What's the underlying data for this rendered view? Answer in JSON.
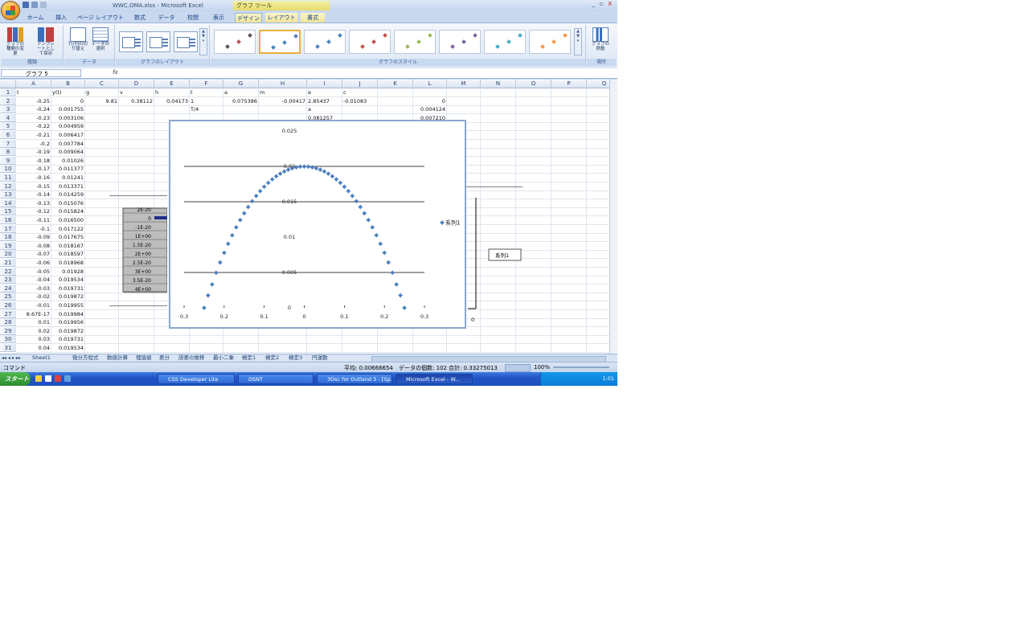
{
  "window": {
    "title": "WWC.OMA.xlsx - Microsoft Excel",
    "context_label": "グラフ ツール",
    "buttons": [
      "_",
      "▫",
      "X"
    ]
  },
  "tabs": [
    "ホーム",
    "挿入",
    "ページ レイアウト",
    "数式",
    "データ",
    "校閲",
    "表示",
    "デザイン",
    "レイアウト",
    "書式"
  ],
  "active_tab": "デザイン",
  "ribbon": {
    "groups": [
      {
        "label": "種類",
        "buttons": [
          "グラフの種類の変更",
          "テンプレートとして保存"
        ]
      },
      {
        "label": "データ",
        "buttons": [
          "行/列の切り替え",
          "データの選択"
        ]
      },
      {
        "label": "グラフのレイアウト"
      },
      {
        "label": "グラフのスタイル"
      },
      {
        "label": "場所",
        "buttons": [
          "グラフの移動"
        ]
      }
    ],
    "style_colors": [
      "#555555",
      "#4f81bd",
      "#4f81bd",
      "#c0504d",
      "#9bbb59",
      "#8064a2",
      "#4bacc6",
      "#f79646"
    ]
  },
  "formula_bar": {
    "name_box": "グラフ 5",
    "fx": "fx"
  },
  "columns": [
    "A",
    "B",
    "C",
    "D",
    "E",
    "F",
    "G",
    "H",
    "I",
    "J",
    "K",
    "L",
    "M",
    "N",
    "O",
    "P",
    "Q"
  ],
  "rows": [
    {
      "n": "1",
      "cells": {
        "A": "t",
        "B": "y(t)",
        "C": "g",
        "D": "v",
        "E": "h",
        "F": "t",
        "G": "a",
        "H": "m",
        "I": "e",
        "J": "c"
      }
    },
    {
      "n": "2",
      "cells": {
        "A": "-0.25",
        "B": "0",
        "C": "9.81",
        "D": "0.38112",
        "E": "0.04173",
        "F": "1",
        "G": "0.075386",
        "H": "-0.00417",
        "I": "2.85437",
        "J": "-0.01083",
        "L": "0"
      }
    },
    {
      "n": "3",
      "cells": {
        "A": "-0.24",
        "B": "0.001755",
        "F": "T/4",
        "I": "a",
        "L": "0.004124"
      }
    },
    {
      "n": "4",
      "cells": {
        "A": "-0.23",
        "B": "0.003106",
        "I": "0.081257",
        "L": "0.007210"
      }
    },
    {
      "n": "5",
      "cells": {
        "A": "-0.22",
        "B": "0.004959"
      }
    },
    {
      "n": "6",
      "cells": {
        "A": "-0.21",
        "B": "0.006417"
      }
    },
    {
      "n": "7",
      "cells": {
        "A": "-0.2",
        "B": "0.007784"
      }
    },
    {
      "n": "8",
      "cells": {
        "A": "-0.19",
        "B": "0.009064"
      }
    },
    {
      "n": "9",
      "cells": {
        "A": "-0.18",
        "B": "0.01026"
      }
    },
    {
      "n": "10",
      "cells": {
        "A": "-0.17",
        "B": "0.011377"
      }
    },
    {
      "n": "11",
      "cells": {
        "A": "-0.16",
        "B": "0.01241"
      }
    },
    {
      "n": "12",
      "cells": {
        "A": "-0.15",
        "B": "0.013371"
      }
    },
    {
      "n": "13",
      "cells": {
        "A": "-0.14",
        "B": "0.014259"
      }
    },
    {
      "n": "14",
      "cells": {
        "A": "-0.13",
        "B": "0.015076"
      }
    },
    {
      "n": "15",
      "cells": {
        "A": "-0.12",
        "B": "0.015824"
      }
    },
    {
      "n": "16",
      "cells": {
        "A": "-0.11",
        "B": "0.016500"
      }
    },
    {
      "n": "17",
      "cells": {
        "A": "-0.1",
        "B": "0.017122"
      }
    },
    {
      "n": "18",
      "cells": {
        "A": "-0.09",
        "B": "0.017675"
      }
    },
    {
      "n": "19",
      "cells": {
        "A": "-0.08",
        "B": "0.018167"
      }
    },
    {
      "n": "20",
      "cells": {
        "A": "-0.07",
        "B": "0.018597"
      }
    },
    {
      "n": "21",
      "cells": {
        "A": "-0.06",
        "B": "0.018968"
      }
    },
    {
      "n": "22",
      "cells": {
        "A": "-0.05",
        "B": "0.01928"
      }
    },
    {
      "n": "23",
      "cells": {
        "A": "-0.04",
        "B": "0.019534"
      }
    },
    {
      "n": "24",
      "cells": {
        "A": "-0.03",
        "B": "0.019731"
      }
    },
    {
      "n": "25",
      "cells": {
        "A": "-0.02",
        "B": "0.019872"
      }
    },
    {
      "n": "26",
      "cells": {
        "A": "-0.01",
        "B": "0.019955"
      }
    },
    {
      "n": "27",
      "cells": {
        "A": "8.67E-17",
        "B": "0.019984"
      }
    },
    {
      "n": "28",
      "cells": {
        "A": "0.01",
        "B": "0.019956"
      }
    },
    {
      "n": "29",
      "cells": {
        "A": "0.02",
        "B": "0.019872"
      }
    },
    {
      "n": "30",
      "cells": {
        "A": "0.03",
        "B": "0.019731"
      }
    },
    {
      "n": "31",
      "cells": {
        "A": "0.04",
        "B": "0.019534"
      }
    }
  ],
  "sheet_tabs": [
    "Sheet1",
    "微分方程式",
    "数値計算",
    "理論値",
    "差分",
    "誤差の推移",
    "最小二乗",
    "検定1",
    "検定2",
    "検定3",
    "円運動"
  ],
  "status": {
    "mode": "コマンド",
    "average": "平均: 0.00666654",
    "count": "データの個数: 102",
    "sum": "合計: 0.33275013",
    "zoom": "100%"
  },
  "taskbar": {
    "start": "スタート",
    "items": [
      "CSS Developer Lite",
      "DSNT",
      "3Dsc for Outland 3 - [Sp...",
      "Microsoft Excel - W..."
    ],
    "clock": "1:01"
  },
  "chart_data": {
    "type": "scatter",
    "title": "",
    "xlabel": "",
    "ylabel": "",
    "xlim": [
      -0.3,
      0.3
    ],
    "ylim": [
      0,
      0.025
    ],
    "x_tick_labels": [
      "0.3",
      "0.2",
      "0.1",
      "0",
      "0.1",
      "0.2",
      "0.3"
    ],
    "y_tick_labels": [
      "0",
      "0.005",
      "0.01",
      "0.015",
      "0.02",
      "0.025"
    ],
    "legend": {
      "entries": [
        "系列1"
      ],
      "position": "right"
    },
    "color": "#4f81bd",
    "series": [
      {
        "name": "系列1",
        "x": [
          -0.25,
          -0.24,
          -0.23,
          -0.22,
          -0.21,
          -0.2,
          -0.19,
          -0.18,
          -0.17,
          -0.16,
          -0.15,
          -0.14,
          -0.13,
          -0.12,
          -0.11,
          -0.1,
          -0.09,
          -0.08,
          -0.07,
          -0.06,
          -0.05,
          -0.04,
          -0.03,
          -0.02,
          -0.01,
          0,
          0.01,
          0.02,
          0.03,
          0.04,
          0.05,
          0.06,
          0.07,
          0.08,
          0.09,
          0.1,
          0.11,
          0.12,
          0.13,
          0.14,
          0.15,
          0.16,
          0.17,
          0.18,
          0.19,
          0.2,
          0.21,
          0.22,
          0.23,
          0.24,
          0.25
        ],
        "y": [
          0,
          0.00176,
          0.00331,
          0.00496,
          0.00642,
          0.00778,
          0.00906,
          0.01026,
          0.01138,
          0.01241,
          0.01337,
          0.01426,
          0.01508,
          0.01582,
          0.0165,
          0.01712,
          0.01768,
          0.01817,
          0.0186,
          0.01897,
          0.01928,
          0.01953,
          0.01973,
          0.01987,
          0.01996,
          0.01998,
          0.01996,
          0.01987,
          0.01973,
          0.01953,
          0.01928,
          0.01897,
          0.0186,
          0.01817,
          0.01768,
          0.01712,
          0.0165,
          0.01582,
          0.01508,
          0.01426,
          0.01337,
          0.01241,
          0.01138,
          0.01026,
          0.00906,
          0.00778,
          0.00642,
          0.00496,
          0.00331,
          0.00176,
          0
        ]
      }
    ]
  },
  "background_charts": {
    "left_labels": [
      "2E-20",
      "0",
      "-1E-20",
      "1E+00",
      "1.5E-20",
      "2E+00",
      "2.5E-20",
      "3E+00",
      "3.5E-20",
      "4E+00"
    ],
    "right_legend": "系列1",
    "right_axis_bottom": "0"
  }
}
